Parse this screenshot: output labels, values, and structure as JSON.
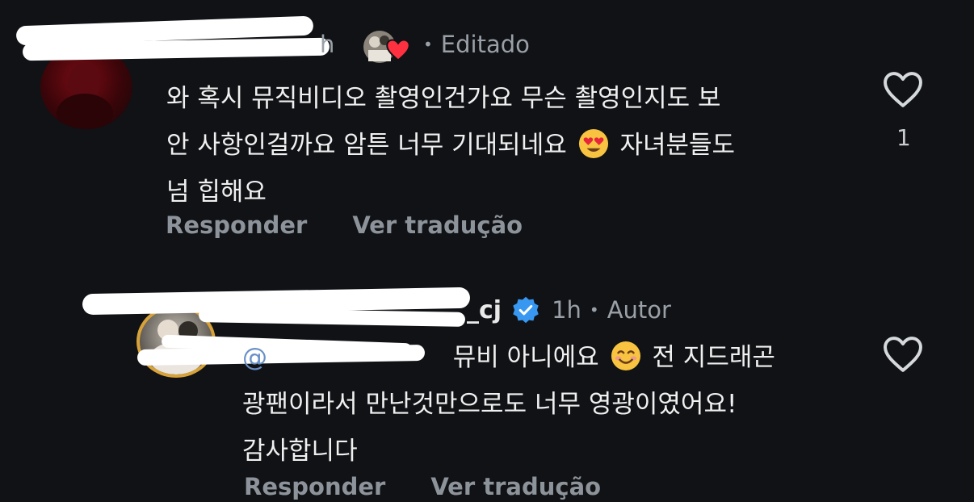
{
  "comments": [
    {
      "time_partial": "h",
      "edited_label": "Editado",
      "text_lines": [
        "와 혹시 뮤직비디오 촬영인건가요 무슨 촬영인지도 보",
        "안 사항인걸까요 암튼 너무 기대되네요",
        "넘 힙해요"
      ],
      "text_after_emoji": "자녀분들도",
      "emoji": "heart-eyes-emoji",
      "like_count": "1",
      "reply_label": "Responder",
      "translate_label": "Ver tradução"
    },
    {
      "username_tail": "_cj",
      "time": "1h",
      "author_label": "Autor",
      "mention_partial": "@",
      "line1_after_mention": "뮤비 아니에요",
      "line1_after_emoji": "전 지드래곤",
      "line2": "광팬이라서 만난것만으로도 너무 영광이였어요!",
      "line3": "감사합니다",
      "emoji": "smiling-emoji",
      "reply_label": "Responder",
      "translate_label": "Ver tradução"
    }
  ],
  "colors": {
    "background": "#101215",
    "meta_text": "#9aa0a8",
    "action_text": "#8d939a",
    "verified_badge": "#3897f0",
    "liked_heart": "#ff3040",
    "story_ring": "#d8a23a"
  },
  "icons": [
    "heart-outline-icon",
    "verified-badge-icon",
    "liked-by-author-heart-icon"
  ]
}
